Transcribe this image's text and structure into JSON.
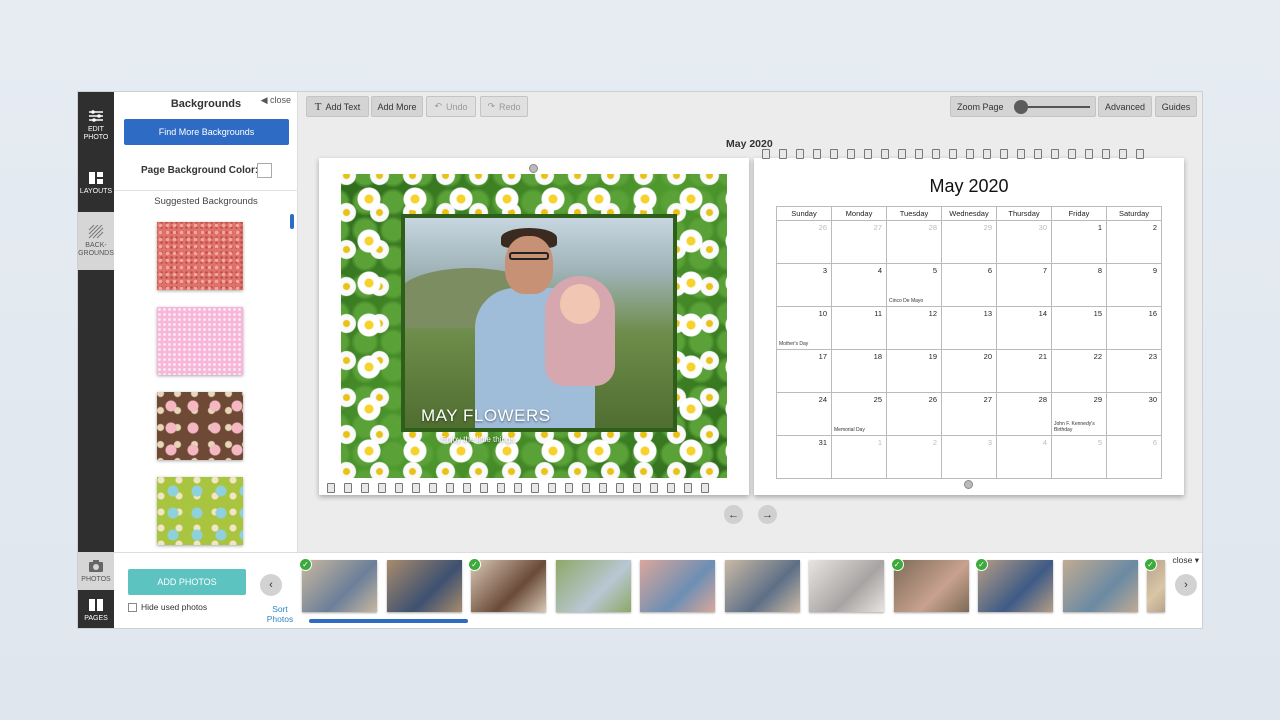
{
  "rail": {
    "items": [
      {
        "label": "EDIT PHOTO",
        "icon": "sliders-icon"
      },
      {
        "label": "LAYOUTS",
        "icon": "layouts-icon"
      },
      {
        "label": "BACK- GROUNDS",
        "icon": "backgrounds-icon"
      }
    ],
    "bottom": [
      {
        "label": "PHOTOS",
        "icon": "camera-icon"
      },
      {
        "label": "PAGES",
        "icon": "book-icon"
      }
    ]
  },
  "panel": {
    "title": "Backgrounds",
    "close": "◀ close",
    "find_more": "Find More Backgrounds",
    "page_bg_label": "Page Background Color:",
    "suggested": "Suggested Backgrounds"
  },
  "toolbar": {
    "add_text": "Add Text",
    "add_more": "Add More",
    "undo": "Undo",
    "redo": "Redo",
    "zoom_page": "Zoom Page",
    "advanced": "Advanced",
    "guides": "Guides",
    "zoom_level": 0.02
  },
  "canvas": {
    "month_title": "May 2020",
    "photo_title": "MAY FLOWERS",
    "photo_subtitle": "Enjoy the little things",
    "calendar": {
      "title": "May 2020",
      "days": [
        "Sunday",
        "Monday",
        "Tuesday",
        "Wednesday",
        "Thursday",
        "Friday",
        "Saturday"
      ],
      "weeks": [
        [
          {
            "n": "26",
            "dim": true
          },
          {
            "n": "27",
            "dim": true
          },
          {
            "n": "28",
            "dim": true
          },
          {
            "n": "29",
            "dim": true
          },
          {
            "n": "30",
            "dim": true
          },
          {
            "n": "1"
          },
          {
            "n": "2"
          }
        ],
        [
          {
            "n": "3"
          },
          {
            "n": "4"
          },
          {
            "n": "5",
            "evt": "Cinco De Mayo"
          },
          {
            "n": "6"
          },
          {
            "n": "7"
          },
          {
            "n": "8"
          },
          {
            "n": "9"
          }
        ],
        [
          {
            "n": "10",
            "evt": "Mother's Day"
          },
          {
            "n": "11"
          },
          {
            "n": "12"
          },
          {
            "n": "13"
          },
          {
            "n": "14"
          },
          {
            "n": "15"
          },
          {
            "n": "16"
          }
        ],
        [
          {
            "n": "17"
          },
          {
            "n": "18"
          },
          {
            "n": "19"
          },
          {
            "n": "20"
          },
          {
            "n": "21"
          },
          {
            "n": "22"
          },
          {
            "n": "23"
          }
        ],
        [
          {
            "n": "24"
          },
          {
            "n": "25",
            "evt": "Memorial Day"
          },
          {
            "n": "26"
          },
          {
            "n": "27"
          },
          {
            "n": "28"
          },
          {
            "n": "29",
            "evt": "John F. Kennedy's Birthday"
          },
          {
            "n": "30"
          }
        ],
        [
          {
            "n": "31"
          },
          {
            "n": "1",
            "dim": true
          },
          {
            "n": "2",
            "dim": true
          },
          {
            "n": "3",
            "dim": true
          },
          {
            "n": "4",
            "dim": true
          },
          {
            "n": "5",
            "dim": true
          },
          {
            "n": "6",
            "dim": true
          }
        ]
      ]
    }
  },
  "bottom": {
    "add_photos": "ADD PHOTOS",
    "hide_used": "Hide used photos",
    "sort_photos": "Sort Photos",
    "close": "close ▾",
    "thumbs": [
      {
        "used": true,
        "colors": [
          "#c9b7a0",
          "#6b7f99"
        ]
      },
      {
        "used": false,
        "colors": [
          "#a98b6c",
          "#3d5170"
        ]
      },
      {
        "used": true,
        "colors": [
          "#d8c8b5",
          "#6a4a38"
        ]
      },
      {
        "used": false,
        "colors": [
          "#8ea867",
          "#b9c7d3"
        ]
      },
      {
        "used": false,
        "colors": [
          "#d9a79b",
          "#6d8fb4"
        ]
      },
      {
        "used": false,
        "colors": [
          "#c9b9a5",
          "#5d6f86"
        ]
      },
      {
        "used": false,
        "colors": [
          "#e8e4e1",
          "#a7a4a3"
        ]
      },
      {
        "used": true,
        "colors": [
          "#7d6b57",
          "#c8a18f"
        ]
      },
      {
        "used": true,
        "colors": [
          "#b59d85",
          "#3e5b86"
        ]
      },
      {
        "used": false,
        "colors": [
          "#c1ab92",
          "#6a8aa3"
        ]
      },
      {
        "used": true,
        "colors": [
          "#b6a38c",
          "#d9c6a6"
        ]
      }
    ]
  },
  "colors": {
    "accent_blue": "#2d6bc4",
    "teal": "#5cc3c1",
    "check_green": "#3cab3c"
  }
}
